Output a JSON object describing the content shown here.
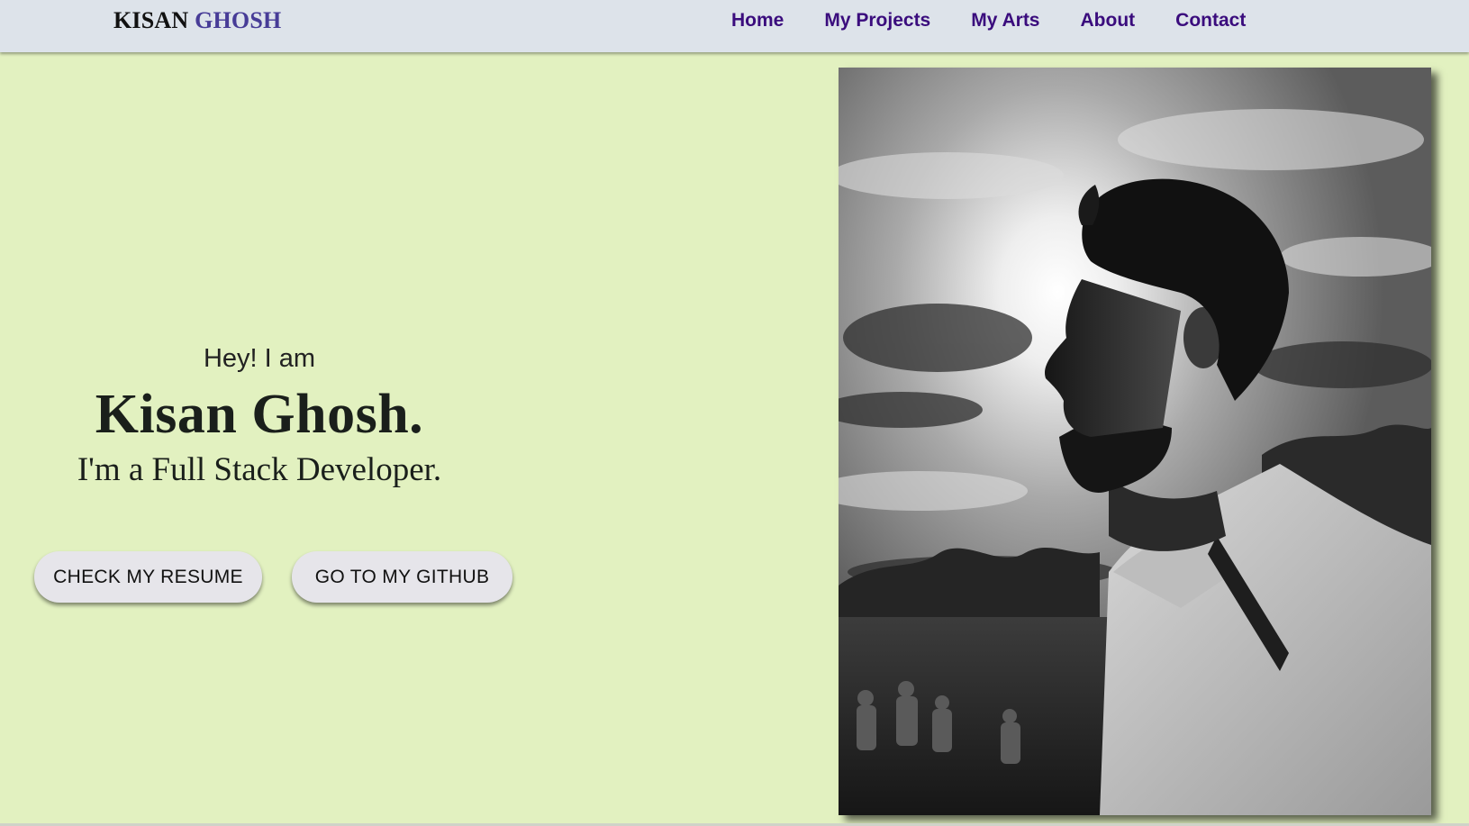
{
  "brand": {
    "first": "KISAN",
    "last": "GHOSH"
  },
  "nav": {
    "items": [
      {
        "label": "Home"
      },
      {
        "label": "My Projects"
      },
      {
        "label": "My Arts"
      },
      {
        "label": "About"
      },
      {
        "label": "Contact"
      }
    ]
  },
  "hero": {
    "greeting": "Hey! I am",
    "name": "Kisan Ghosh.",
    "role": "I'm a Full Stack Developer.",
    "resume_button": "CHECK MY RESUME",
    "github_button": "GO TO MY GITHUB"
  },
  "colors": {
    "background": "#e2f1c0",
    "navbar": "#dde3ea",
    "nav_link": "#3a0c7d",
    "brand_accent": "#473c97",
    "button": "#e6e5ea"
  }
}
